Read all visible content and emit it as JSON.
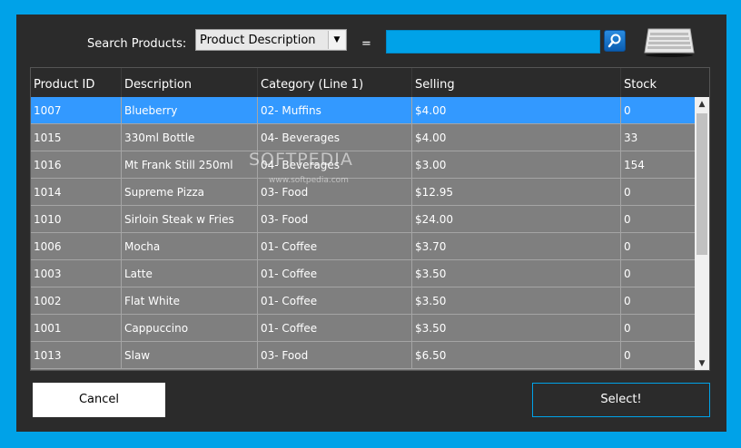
{
  "search": {
    "label": "Search Products:",
    "field_selected": "Product Description",
    "equals": "=",
    "value": ""
  },
  "columns": [
    "Product ID",
    "Description",
    "Category (Line 1)",
    "Selling",
    "Stock"
  ],
  "rows": [
    {
      "id": "1007",
      "description": "Blueberry",
      "category": "02- Muffins",
      "selling": "$4.00",
      "stock": "0",
      "selected": true
    },
    {
      "id": "1015",
      "description": "330ml Bottle",
      "category": "04- Beverages",
      "selling": "$4.00",
      "stock": "33"
    },
    {
      "id": "1016",
      "description": "Mt Frank Still 250ml",
      "category": "04- Beverages",
      "selling": "$3.00",
      "stock": "154"
    },
    {
      "id": "1014",
      "description": "Supreme Pizza",
      "category": "03- Food",
      "selling": "$12.95",
      "stock": "0"
    },
    {
      "id": "1010",
      "description": "Sirloin Steak w Fries",
      "category": "03- Food",
      "selling": "$24.00",
      "stock": "0"
    },
    {
      "id": "1006",
      "description": "Mocha",
      "category": "01- Coffee",
      "selling": "$3.70",
      "stock": "0"
    },
    {
      "id": "1003",
      "description": "Latte",
      "category": "01- Coffee",
      "selling": "$3.50",
      "stock": "0"
    },
    {
      "id": "1002",
      "description": "Flat White",
      "category": "01- Coffee",
      "selling": "$3.50",
      "stock": "0"
    },
    {
      "id": "1001",
      "description": "Cappuccino",
      "category": "01- Coffee",
      "selling": "$3.50",
      "stock": "0"
    },
    {
      "id": "1013",
      "description": "Slaw",
      "category": "03- Food",
      "selling": "$6.50",
      "stock": "0"
    }
  ],
  "watermark": {
    "text": "SOFTPEDIA",
    "url": "www.softpedia.com"
  },
  "buttons": {
    "cancel": "Cancel",
    "select": "Select!"
  },
  "colors": {
    "accent": "#00a2e8",
    "selection": "#3399ff",
    "window": "#2b2b2b",
    "grid": "#7f7f7f"
  },
  "icons": {
    "search": "magnifier-icon",
    "keyboard": "keyboard-icon",
    "dropdown": "chevron-down-icon"
  }
}
